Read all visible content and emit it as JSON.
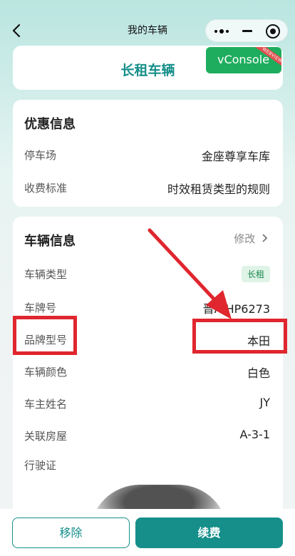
{
  "nav": {
    "title": "我的车辆"
  },
  "header": {
    "title": "长租车辆"
  },
  "vconsole": {
    "label": "vConsole",
    "badge": "WEBVIEW"
  },
  "promo": {
    "title": "优惠信息",
    "rows": [
      {
        "label": "停车场",
        "value": "金座尊享车库"
      },
      {
        "label": "收费标准",
        "value": "时效租赁类型的规则"
      }
    ]
  },
  "vehicle": {
    "title": "车辆信息",
    "edit": "修改",
    "type": {
      "label": "车辆类型",
      "tag": "长租"
    },
    "plate": {
      "label": "车牌号",
      "value": "晋A HP6273"
    },
    "brand": {
      "label": "品牌型号",
      "value": "本田"
    },
    "color": {
      "label": "车辆颜色",
      "value": "白色"
    },
    "owner": {
      "label": "车主姓名",
      "value": "JY"
    },
    "house": {
      "label": "关联房屋",
      "value": "A-3-1"
    },
    "license": {
      "label": "行驶证"
    }
  },
  "actions": {
    "remove": "移除",
    "renew": "续费"
  },
  "colors": {
    "accent": "#168f8a",
    "annotation": "#e0262e",
    "vconsole": "#1ead5e"
  }
}
